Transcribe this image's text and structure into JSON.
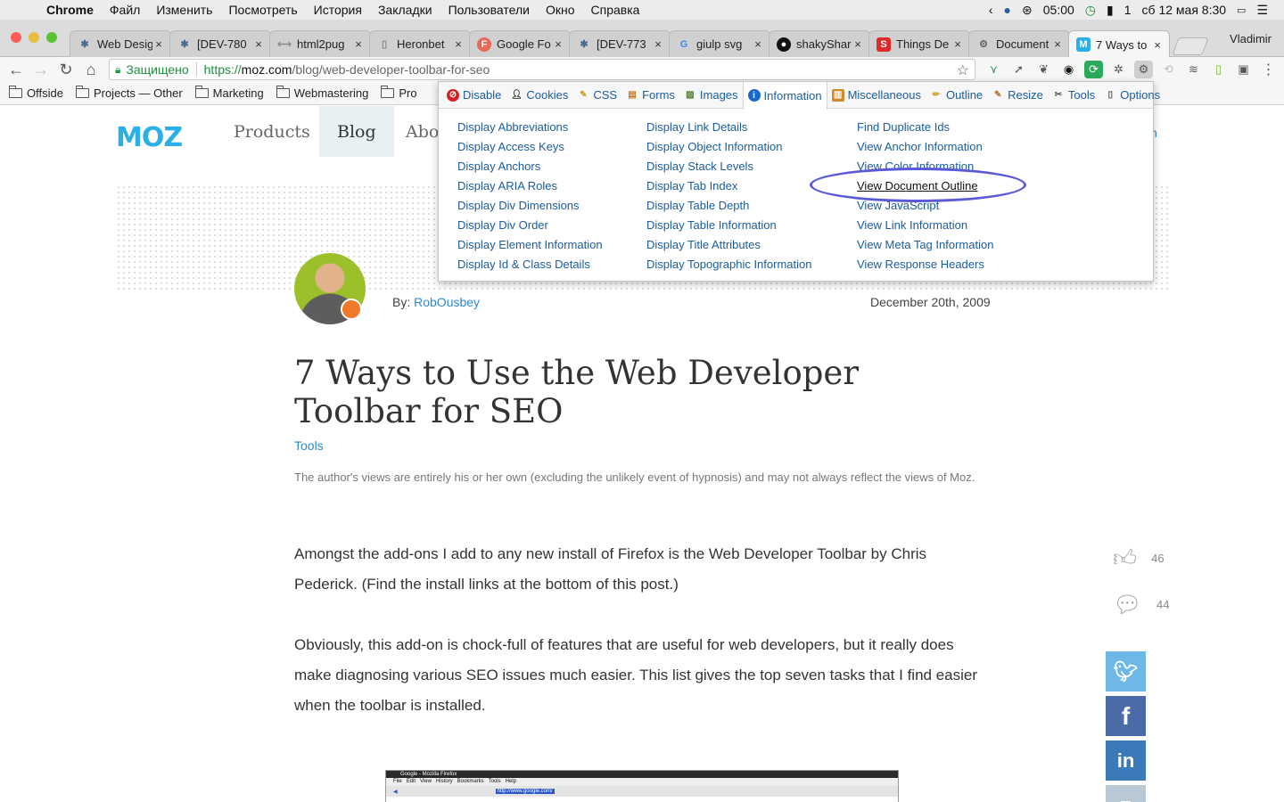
{
  "os_menubar": {
    "app_name": "Chrome",
    "items": [
      "Файл",
      "Изменить",
      "Посмотреть",
      "История",
      "Закладки",
      "Пользователи",
      "Окно",
      "Справка"
    ],
    "status": {
      "time_left": "05:00",
      "battery_pct": "1",
      "date_time": "сб 12 мая  8:30"
    }
  },
  "browser": {
    "tabs": [
      {
        "title": "Web Desig",
        "active": false
      },
      {
        "title": "[DEV-780",
        "active": false
      },
      {
        "title": "html2pug",
        "active": false
      },
      {
        "title": "Heronbet",
        "active": false
      },
      {
        "title": "Google Fo",
        "active": false
      },
      {
        "title": "[DEV-773",
        "active": false
      },
      {
        "title": "giulp svg",
        "active": false
      },
      {
        "title": "shakyShar",
        "active": false
      },
      {
        "title": "Things De",
        "active": false
      },
      {
        "title": "Document",
        "active": false
      },
      {
        "title": "7 Ways to",
        "active": true
      }
    ],
    "profile_name": "Vladimir",
    "omnibox": {
      "secure_label": "Защищено",
      "scheme": "https://",
      "host": "moz.com",
      "path": "/blog/web-developer-toolbar-for-seo"
    },
    "bookmarks": [
      "Offside",
      "Projects — Other",
      "Marketing",
      "Webmastering",
      "Pro"
    ]
  },
  "site_nav": {
    "logo": "MOZ",
    "items": [
      "Products",
      "Blog",
      "About"
    ],
    "signin": "n"
  },
  "article": {
    "byline_prefix": "By:",
    "author": "RobOusbey",
    "date": "December 20th, 2009",
    "title": "7 Ways to Use the Web Developer Toolbar for SEO",
    "category": "Tools",
    "disclaimer": "The author's views are entirely his or her own (excluding the unlikely event of hypnosis) and may not always reflect the views of Moz.",
    "paragraphs": [
      "Amongst the add-ons I add to any new install of Firefox is the Web Developer Toolbar by Chris Pederick. (Find the install links at the bottom of this post.)",
      "Obviously, this add-on is chock-full of features that are useful for web developers, but it really does make diagnosing various SEO issues much easier. This list gives the top seven tasks that I find easier when the toolbar is installed."
    ],
    "likes": "46",
    "comments": "44"
  },
  "embedded_screenshot": {
    "title": "Google - Mozilla Firefox",
    "menu": [
      "File",
      "Edit",
      "View",
      "History",
      "Bookmarks",
      "Tools",
      "Help"
    ],
    "url": "http://www.google.com/"
  },
  "web_developer": {
    "tabs": [
      {
        "label": "Disable",
        "icon": "disable-icon",
        "color": "#d42020"
      },
      {
        "label": "Cookies",
        "icon": "cookies-icon",
        "color": "#222222"
      },
      {
        "label": "CSS",
        "icon": "css-icon",
        "color": "#c9a227"
      },
      {
        "label": "Forms",
        "icon": "forms-icon",
        "color": "#c07a2a"
      },
      {
        "label": "Images",
        "icon": "images-icon",
        "color": "#4a7a2a"
      },
      {
        "label": "Information",
        "icon": "information-icon",
        "color": "#1a6ac9",
        "active": true
      },
      {
        "label": "Miscellaneous",
        "icon": "miscellaneous-icon",
        "color": "#d08a2a"
      },
      {
        "label": "Outline",
        "icon": "outline-icon",
        "color": "#d0a02a"
      },
      {
        "label": "Resize",
        "icon": "resize-icon",
        "color": "#b07a3a"
      },
      {
        "label": "Tools",
        "icon": "tools-icon",
        "color": "#555555"
      },
      {
        "label": "Options",
        "icon": "options-icon",
        "color": "#555555"
      }
    ],
    "columns": [
      [
        "Display Abbreviations",
        "Display Access Keys",
        "Display Anchors",
        "Display ARIA Roles",
        "Display Div Dimensions",
        "Display Div Order",
        "Display Element Information",
        "Display Id & Class Details"
      ],
      [
        "Display Link Details",
        "Display Object Information",
        "Display Stack Levels",
        "Display Tab Index",
        "Display Table Depth",
        "Display Table Information",
        "Display Title Attributes",
        "Display Topographic Information"
      ],
      [
        "Find Duplicate Ids",
        "View Anchor Information",
        "View Color Information",
        "View Document Outline",
        "View JavaScript",
        "View Link Information",
        "View Meta Tag Information",
        "View Response Headers"
      ]
    ],
    "highlighted": "View Document Outline"
  },
  "colors": {
    "moz_blue": "#2ab0e6",
    "link": "#1a5c9e",
    "twitter": "#6db8e6",
    "facebook": "#4b6aa8",
    "linkedin": "#3a7ab8",
    "annotation": "#5a5ad8"
  }
}
